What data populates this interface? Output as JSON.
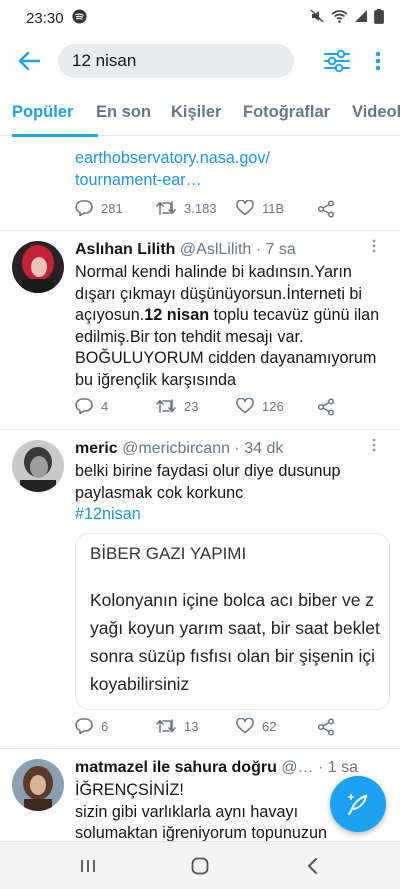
{
  "status": {
    "time": "23:30"
  },
  "search": {
    "query": "12 nisan"
  },
  "tabs": [
    "Popüler",
    "En son",
    "Kişiler",
    "Fotoğraflar",
    "Videolar"
  ],
  "tweets": [
    {
      "link_line1": "earthobservatory.nasa.gov/",
      "link_line2": "tournament-ear…",
      "replies": "281",
      "retweets": "3.183",
      "likes": "11B"
    },
    {
      "name": "Aslıhan Lilith",
      "handle": "@AslLilith · 7 sa",
      "text_lines": [
        "Normal kendi halinde bi kadınsın.Yarın",
        "dışarı çıkmayı düşünüyorsun.İnterneti bi",
        "açıyosun.",
        " toplu tecavüz günü ilan",
        "edilmiş.Bir ton tehdit mesajı var.",
        "BOĞULUYORUM cidden dayanamıyorum",
        "bu iğrençlik karşısında"
      ],
      "bold": "12 nisan",
      "replies": "4",
      "retweets": "23",
      "likes": "126"
    },
    {
      "name": "meric",
      "handle": "@mericbircann · 34 dk",
      "text_lines": [
        "belki birine faydasi olur diye dusunup",
        "paylasmak cok korkunc"
      ],
      "hashtag": "#12nisan",
      "card_title": "BİBER GAZI YAPIMI",
      "card_lines": [
        "Kolonyanın içine bolca acı biber ve z",
        "yağı koyun yarım saat, bir saat beklet",
        "sonra süzüp fısfısı olan bir şişenin içi",
        "koyabilirsiniz"
      ],
      "replies": "6",
      "retweets": "13",
      "likes": "62"
    },
    {
      "name": "matmazel ile sahura doğru",
      "handle": "@… · 1 sa",
      "text_lines": [
        "İĞRENÇSİNİZ!",
        "sizin gibi varlıklarla aynı havayı",
        "solumaktan iğreniyorum topunuzun"
      ]
    }
  ],
  "colors": {
    "accent": "#1da1f2",
    "muted": "#657786",
    "link": "#1b95e0"
  }
}
